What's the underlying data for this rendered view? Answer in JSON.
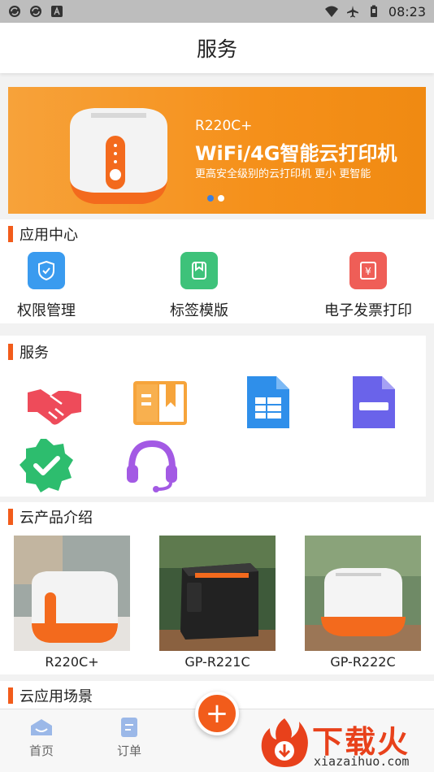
{
  "status_bar": {
    "time": "08:23",
    "left_icons": [
      "sync-icon",
      "sync-icon",
      "a-box-icon"
    ],
    "right_icons": [
      "wifi-icon",
      "airplane-icon",
      "battery-icon"
    ]
  },
  "header": {
    "title": "服务"
  },
  "banner": {
    "model": "R220C+",
    "headline": "WiFi/4G智能云打印机",
    "tagline": "更高安全级别的云打印机 更小 更智能",
    "slides": 2,
    "active_slide": 1
  },
  "app_center": {
    "title": "应用中心",
    "items": [
      {
        "label": "权限管理",
        "icon": "shield-icon",
        "color": "#3a9bef"
      },
      {
        "label": "标签模版",
        "icon": "bookmark-icon",
        "color": "#3ec27a"
      },
      {
        "label": "电子发票打印",
        "icon": "invoice-icon",
        "color": "#ef5e57"
      }
    ]
  },
  "services": {
    "title": "服务",
    "items": [
      {
        "icon": "handshake-icon",
        "color": "#ee4b5a"
      },
      {
        "icon": "book-icon",
        "color": "#f6a43b"
      },
      {
        "icon": "spreadsheet-icon",
        "color": "#2f8fea"
      },
      {
        "icon": "document-icon",
        "color": "#6a63ea"
      },
      {
        "icon": "verified-check-icon",
        "color": "#2dbd6e"
      },
      {
        "icon": "headset-icon",
        "color": "#a35ae4"
      }
    ]
  },
  "products": {
    "title": "云产品介绍",
    "items": [
      {
        "name": "R220C+"
      },
      {
        "name": "GP-R221C"
      },
      {
        "name": "GP-R222C"
      }
    ]
  },
  "scenes": {
    "title": "云应用场景"
  },
  "tabbar": {
    "tabs": [
      {
        "label": "首页",
        "icon": "home-icon"
      },
      {
        "label": "订单",
        "icon": "order-icon"
      }
    ],
    "fab_symbol": "+"
  },
  "watermark": {
    "text": "下载火",
    "url": "xiazaihuo.com"
  },
  "colors": {
    "accent": "#f25c1b",
    "banner": "#f5901a",
    "header_bg": "#ffffff"
  }
}
